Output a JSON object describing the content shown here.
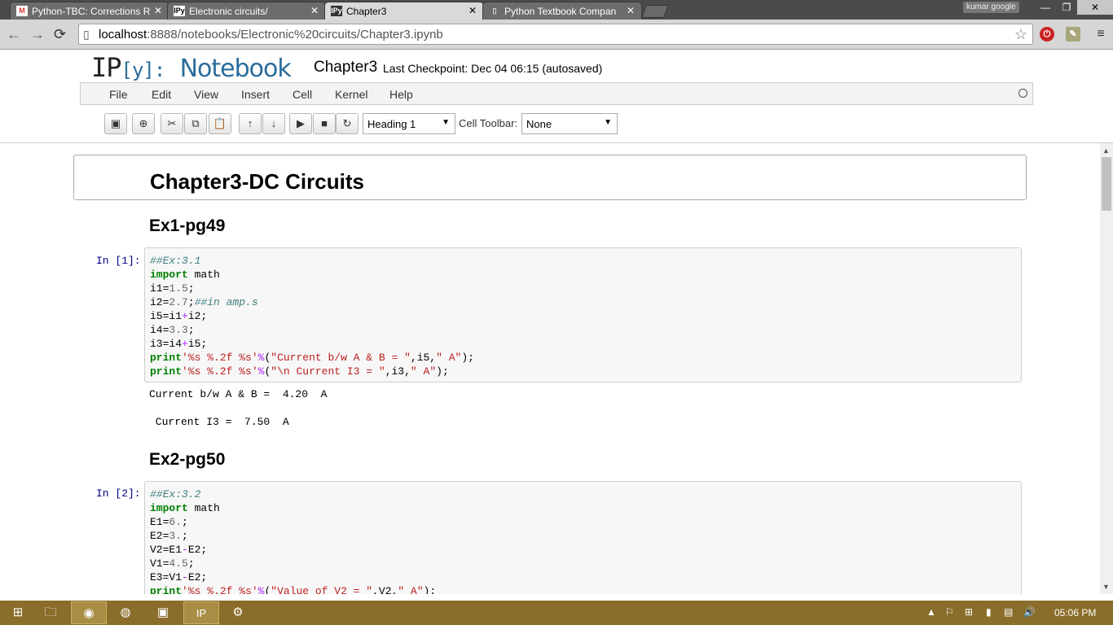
{
  "browser": {
    "tabs": [
      {
        "label": "Python-TBC: Corrections R",
        "icon": "gmail-icon",
        "active": false
      },
      {
        "label": "Electronic circuits/",
        "icon": "ipython-icon",
        "active": false
      },
      {
        "label": "Chapter3",
        "icon": "ipython-icon",
        "active": true
      },
      {
        "label": "Python Textbook Compan",
        "icon": "page-icon",
        "active": false
      }
    ],
    "profile_name": "kumar google",
    "url_host": "localhost",
    "url_rest": ":8888/notebooks/Electronic%20circuits/Chapter3.ipynb"
  },
  "notebook": {
    "logo_ip": "IP",
    "logo_y": "[y]:",
    "logo_word": "Notebook",
    "name": "Chapter3",
    "checkpoint": "Last Checkpoint: Dec 04 06:15 (autosaved)",
    "menu": [
      "File",
      "Edit",
      "View",
      "Insert",
      "Cell",
      "Kernel",
      "Help"
    ],
    "cell_type_select": "Heading 1",
    "cell_toolbar_label": "Cell Toolbar:",
    "cell_toolbar_select": "None"
  },
  "cells": {
    "heading1": "Chapter3-DC Circuits",
    "ex1_heading": "Ex1-pg49",
    "ex1_prompt": "In [1]:",
    "ex1_output1": "Current b/w A & B =  4.20  A",
    "ex1_output2": " Current I3 =  7.50  A",
    "ex2_heading": "Ex2-pg50",
    "ex2_prompt": "In [2]:"
  },
  "taskbar": {
    "clock": "05:06 PM",
    "items": [
      "start-icon",
      "file-explorer-icon",
      "chrome-icon",
      "firefox-icon",
      "media-icon",
      "ipython-icon",
      "network-app-icon"
    ]
  },
  "colors": {
    "taskbar": "#8a6d2a",
    "logo_blue": "#2a6c9c",
    "code_keyword": "#008000",
    "code_comment": "#408080",
    "code_string": "#ba2121"
  }
}
